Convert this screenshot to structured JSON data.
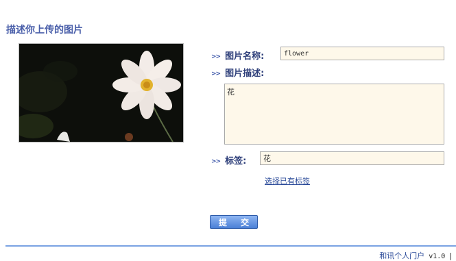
{
  "page": {
    "title": "描述你上传的图片"
  },
  "form": {
    "name_label": "图片名称:",
    "name_value": "flower",
    "desc_label": "图片描述:",
    "desc_value": "花",
    "tags_label": "标签:",
    "tags_value": "花",
    "choose_tags_link": "选择已有标签",
    "submit_label": "提 交",
    "arrow_glyph": ">>"
  },
  "footer": {
    "brand": "和讯个人门户",
    "version": "v1.0",
    "separator": "|"
  },
  "image": {
    "subject": "white-flower-photo"
  },
  "colors": {
    "title": "#4a5faa",
    "input_bg": "#fef8ea",
    "divider": "#7aa2e3",
    "button": "#4a7fd6"
  }
}
